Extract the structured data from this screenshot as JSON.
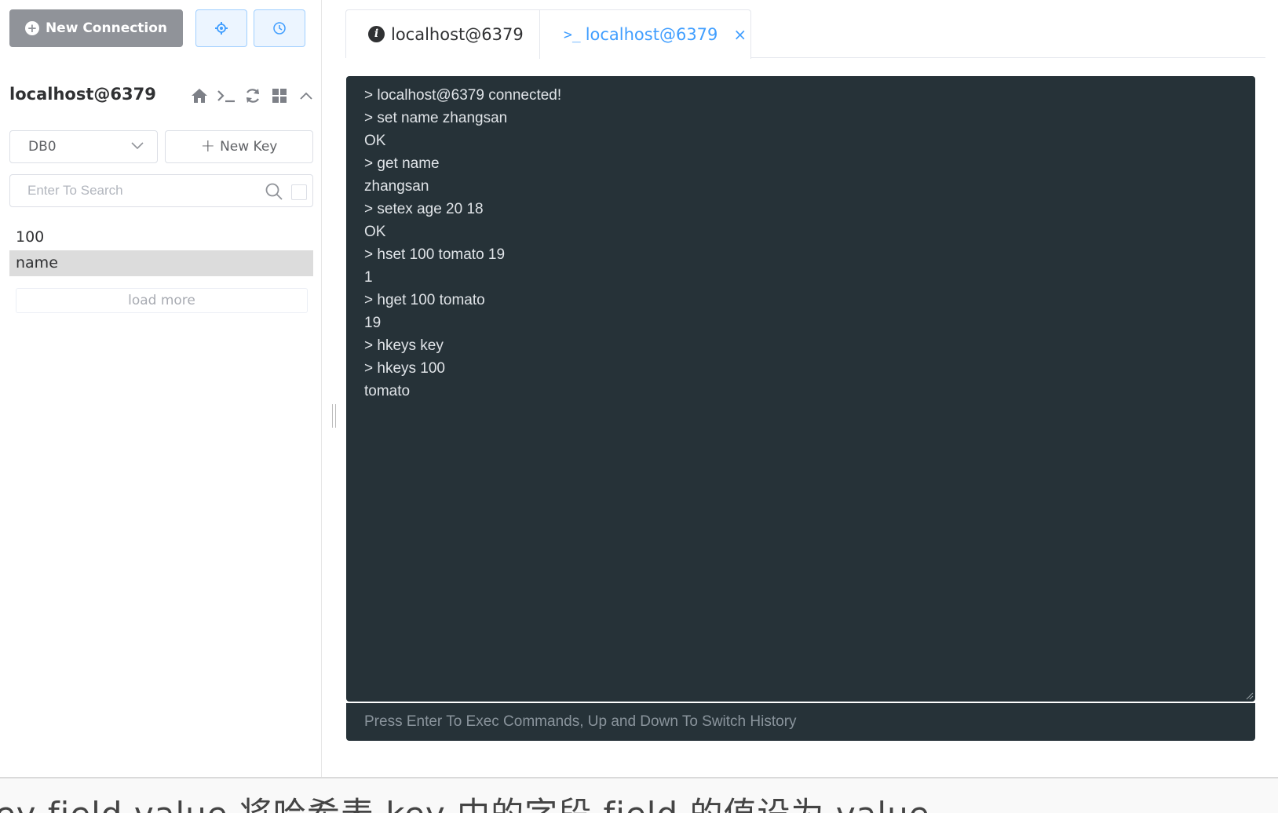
{
  "toolbar": {
    "new_connection_label": "New Connection",
    "settings_icon": "settings-gear-icon",
    "history_icon": "clock-icon"
  },
  "connection": {
    "title": "localhost@6379",
    "actions": [
      "home-icon",
      "terminal-icon",
      "refresh-icon",
      "grid-icon",
      "chevron-up-icon"
    ]
  },
  "db_select": {
    "value": "DB0"
  },
  "new_key": {
    "label": "New Key"
  },
  "search": {
    "placeholder": "Enter To Search"
  },
  "keys": [
    {
      "name": "100",
      "selected": false
    },
    {
      "name": "name",
      "selected": true
    }
  ],
  "load_more": "load more",
  "tabs": [
    {
      "label": "localhost@6379",
      "icon": "info-icon",
      "active": false
    },
    {
      "label": "localhost@6379",
      "icon": "terminal-icon",
      "active": true,
      "prefix": ">_"
    }
  ],
  "terminal": {
    "lines": [
      "> localhost@6379 connected!",
      "> set name zhangsan",
      "OK",
      "> get name",
      "zhangsan",
      "> setex age 20 18",
      "OK",
      "> hset 100 tomato 19",
      "1",
      "> hget 100 tomato",
      "19",
      "> hkeys key",
      "> hkeys 100",
      "tomato"
    ],
    "input_placeholder": "Press Enter To Exec Commands, Up and Down To Switch History"
  },
  "bottom_caption": "key field value      将哈希表 key 中的字段 field 的值设为 value",
  "colors": {
    "accent": "#409eff",
    "terminal_bg": "#263238",
    "primary_gray": "#909399"
  }
}
